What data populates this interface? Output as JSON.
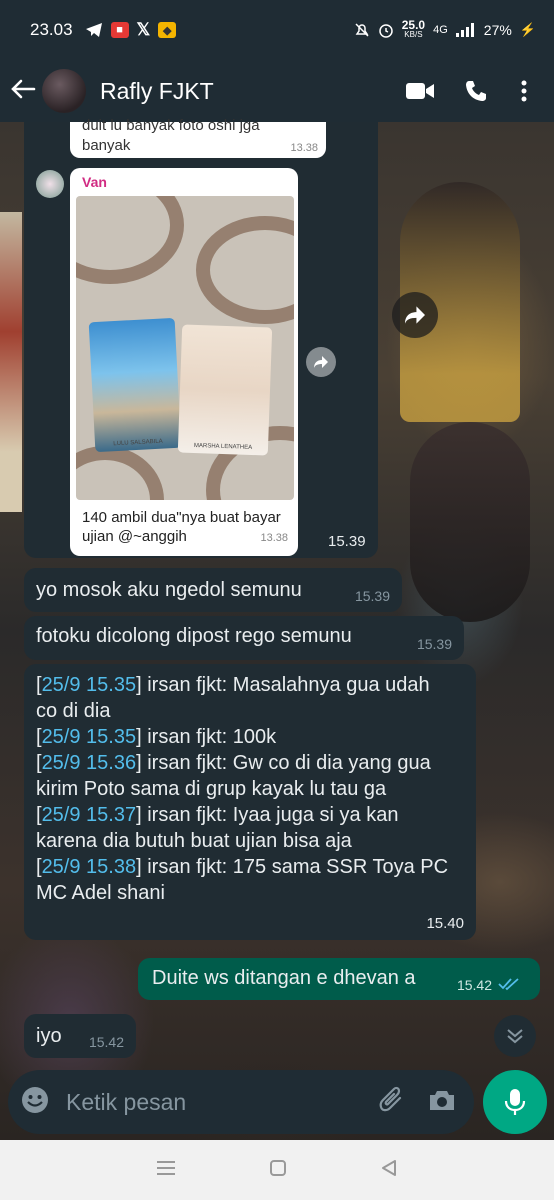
{
  "status_bar": {
    "time": "23.03",
    "network_speed": "25.0",
    "network_unit": "KB/S",
    "network_type": "4G",
    "battery": "27%"
  },
  "header": {
    "contact_name": "Rafly FJKT"
  },
  "messages": [
    {
      "type": "quoted-forward",
      "quote_top_text": "duit lu banyak foto oshi jga banyak",
      "quote_top_time": "13.38",
      "quote_sender": "Van",
      "quote_caption": "140 ambil dua\"nya buat bayar ujian @~anggih",
      "quote_time": "13.38",
      "card_left_label": "LULU SALSABILA",
      "card_right_label": "MARSHA LENATHEA",
      "time": "15.39"
    },
    {
      "type": "incoming",
      "text": "yo mosok aku ngedol semunu",
      "time": "15.39"
    },
    {
      "type": "incoming",
      "text": "fotoku dicolong dipost rego semunu",
      "time": "15.39"
    },
    {
      "type": "incoming-log",
      "lines": [
        {
          "ts": "25/9 15.35",
          "text": "irsan fjkt: Masalahnya gua udah co di dia"
        },
        {
          "ts": "25/9 15.35",
          "text": "irsan fjkt: 100k"
        },
        {
          "ts": "25/9 15.36",
          "text": "irsan fjkt: Gw co di dia yang gua kirim Poto sama di grup kayak lu tau ga"
        },
        {
          "ts": "25/9 15.37",
          "text": "irsan fjkt: Iyaa juga si ya kan karena dia butuh buat ujian bisa aja"
        },
        {
          "ts": "25/9 15.38",
          "text": "irsan fjkt: 175 sama SSR Toya PC MC Adel shani"
        }
      ],
      "time": "15.40"
    },
    {
      "type": "outgoing",
      "text": "Duite ws ditangan e dhevan a",
      "time": "15.42"
    },
    {
      "type": "incoming",
      "text": "iyo",
      "time": "15.42"
    }
  ],
  "composer": {
    "placeholder": "Ketik pesan"
  },
  "colors": {
    "header_bg": "#1f2c34",
    "incoming_bubble": "#202c33",
    "outgoing_bubble": "#005c4b",
    "accent": "#00a884",
    "link": "#53bdeb"
  },
  "icons": [
    "back-arrow-icon",
    "video-call-icon",
    "phone-icon",
    "more-menu-icon",
    "forward-icon",
    "emoji-icon",
    "attach-icon",
    "camera-icon",
    "mic-icon",
    "chevron-double-down-icon",
    "double-check-icon"
  ]
}
